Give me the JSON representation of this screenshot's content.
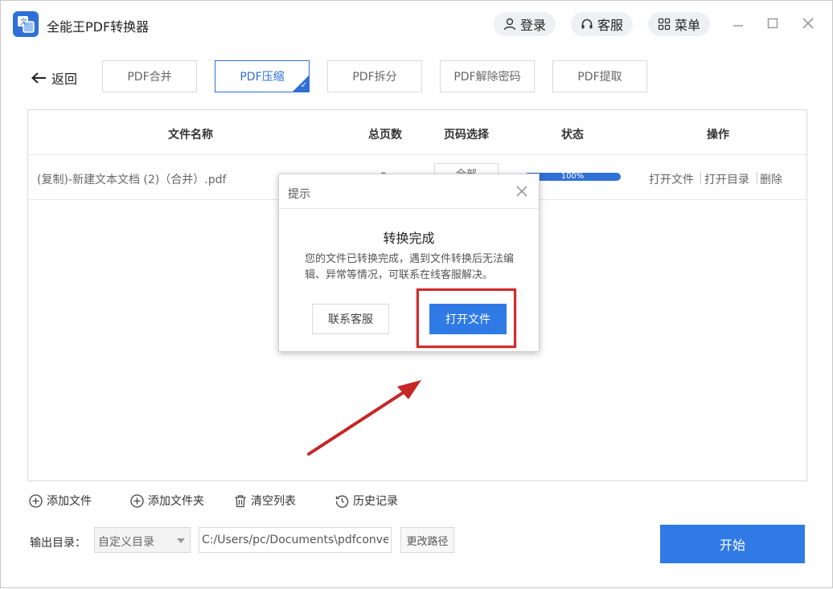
{
  "app": {
    "title": "全能王PDF转换器",
    "accent_color": "#2f6fd6",
    "header_buttons": [
      {
        "label": "登录",
        "icon": "user-icon"
      },
      {
        "label": "客服",
        "icon": "headset-icon"
      },
      {
        "label": "菜单",
        "icon": "grid-icon"
      }
    ]
  },
  "nav": {
    "back_label": "返回",
    "tabs": [
      {
        "label": "PDF合并",
        "active": false
      },
      {
        "label": "PDF压缩",
        "active": true
      },
      {
        "label": "PDF拆分",
        "active": false
      },
      {
        "label": "PDF解除密码",
        "active": false
      },
      {
        "label": "PDF提取",
        "active": false
      }
    ]
  },
  "table": {
    "headers": {
      "name": "文件名称",
      "pages": "总页数",
      "page_select": "页码选择",
      "status": "状态",
      "ops": "操作"
    },
    "rows": [
      {
        "name": "(复制)-新建文本文档 (2)（合并）.pdf",
        "pages": "2",
        "page_select": "全部",
        "progress": 1.0,
        "progress_text": "100%",
        "ops": [
          "打开文件",
          "打开目录",
          "删除"
        ]
      }
    ]
  },
  "toolbar": {
    "add_file": "添加文件",
    "add_folder": "添加文件夹",
    "clear_list": "清空列表",
    "history": "历史记录"
  },
  "output": {
    "label": "输出目录：",
    "mode": "自定义目录",
    "path": "C:/Users/pc/Documents\\pdfconvert",
    "change_label": "更改路径",
    "start_label": "开始"
  },
  "dialog": {
    "title": "提示",
    "heading": "转换完成",
    "message": "您的文件已转换完成，遇到文件转换后无法编辑、异常等情况，可联系在线客服解决。",
    "cancel_label": "联系客服",
    "ok_label": "打开文件"
  }
}
